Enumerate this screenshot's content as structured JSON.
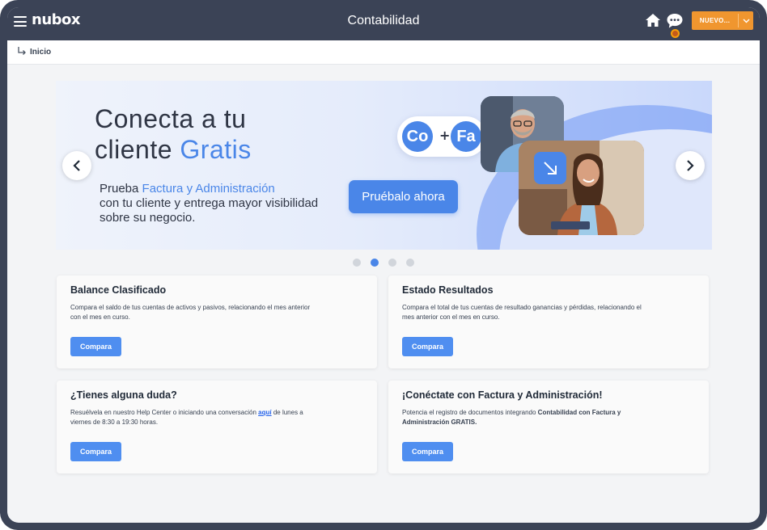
{
  "header": {
    "logo": "nubox",
    "title": "Contabilidad",
    "nuevo_label": "NUEVO...",
    "colors": {
      "bar": "#3b4356",
      "nuevo": "#f0962f"
    },
    "icons": [
      "menu-icon",
      "home-icon",
      "chat-icon",
      "chevron-down-icon"
    ]
  },
  "breadcrumb": {
    "label": "Inicio"
  },
  "banner": {
    "title_line1": "Conecta a tu",
    "title_line2_plain": "cliente ",
    "title_line2_accent": "Gratis",
    "sub_plain1": "Prueba ",
    "sub_accent": "Factura y Administración",
    "sub_plain2": "con tu cliente y entrega mayor visibilidad sobre su negocio.",
    "cta": "Pruébalo ahora",
    "badge_left": "Co",
    "badge_plus": "+",
    "badge_right": "Fa",
    "accent_color": "#4a86e8"
  },
  "carousel": {
    "active_index": 2,
    "total": 4
  },
  "cards": [
    {
      "title": "Balance Clasificado",
      "desc": "Compara el saldo de tus cuentas de activos y pasivos, relacionando el mes anterior con el mes en curso.",
      "button": "Compara"
    },
    {
      "title": "Estado Resultados",
      "desc": "Compara el total de tus cuentas de resultado ganancias y pérdidas, relacionando el mes anterior con el mes en curso.",
      "button": "Compara"
    },
    {
      "title": "¿Tienes alguna duda?",
      "desc_before": "Resuélvela en nuestro Help Center o iniciando una conversación ",
      "desc_link": "aquí",
      "desc_after": " de lunes a viernes de 8:30 a 19:30 horas.",
      "button": "Compara"
    },
    {
      "title": "¡Conéctate con Factura y Administración!",
      "desc_before": "Potencia el registro de documentos integrando ",
      "desc_bold": "Contabilidad con Factura y Administración GRATIS.",
      "button": "Compara"
    }
  ]
}
